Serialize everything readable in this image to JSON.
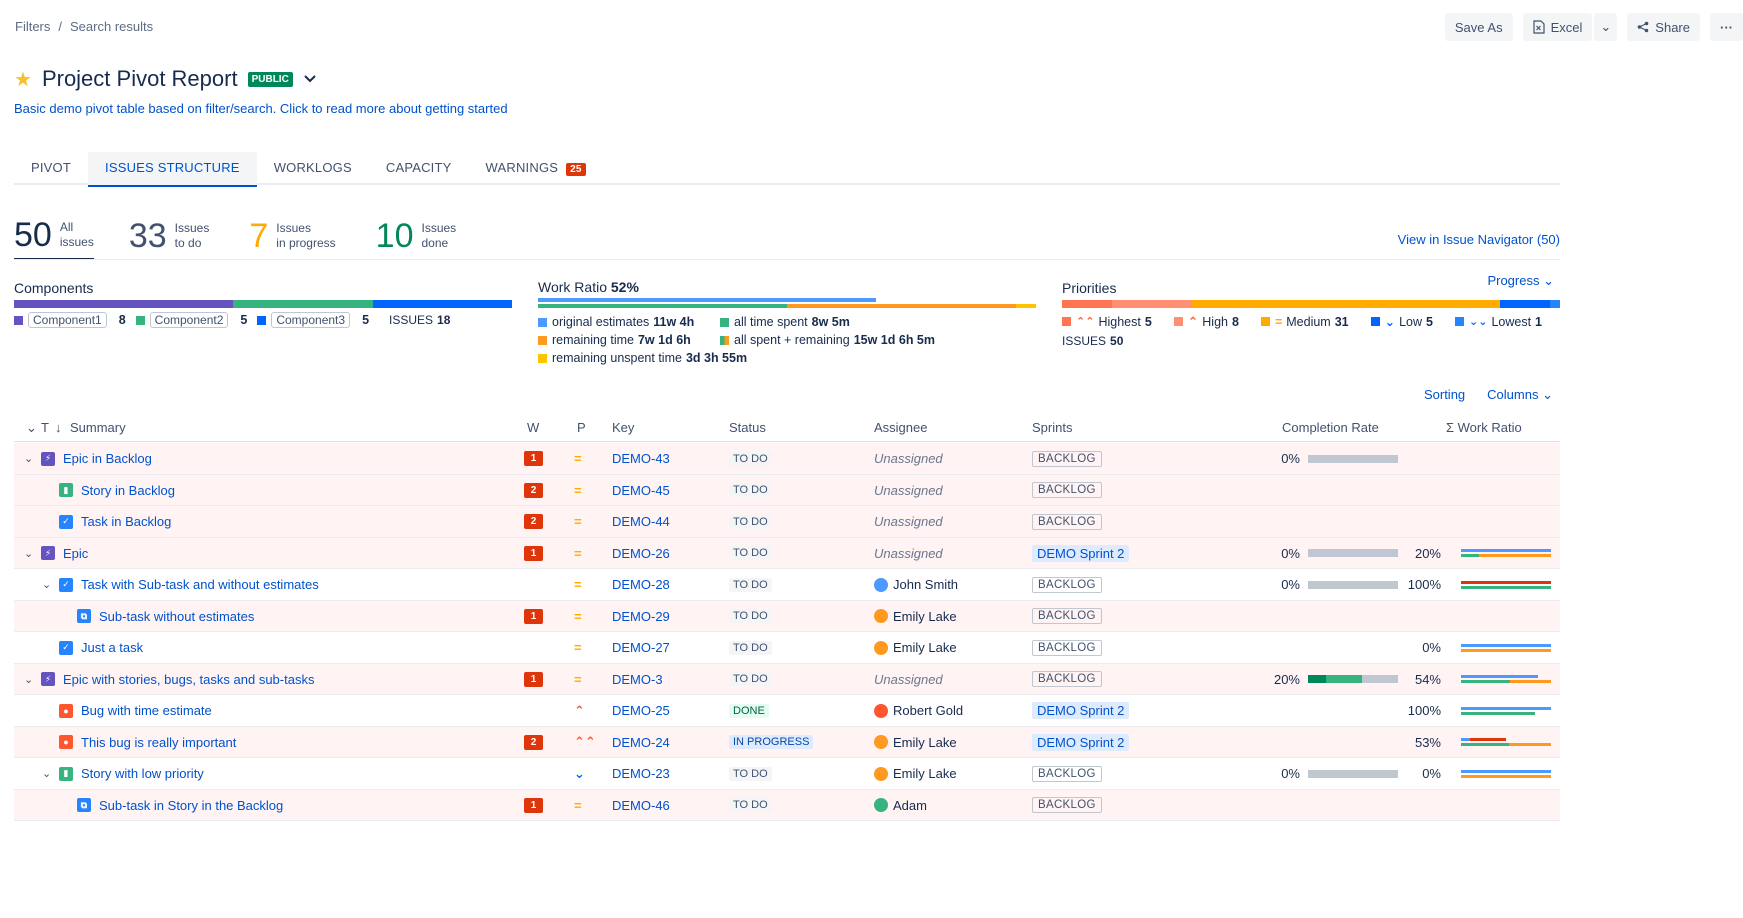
{
  "breadcrumb": [
    "Filters",
    "/",
    "Search results"
  ],
  "toolbar": {
    "save_as": "Save As",
    "excel": "Excel",
    "share": "Share",
    "more": "···"
  },
  "title": "Project Pivot Report",
  "public_badge": "PUBLIC",
  "subtitle": "Basic demo pivot table based on filter/search. Click to read more about getting started",
  "tabs": [
    {
      "label": "PIVOT"
    },
    {
      "label": "ISSUES STRUCTURE",
      "active": true
    },
    {
      "label": "WORKLOGS"
    },
    {
      "label": "CAPACITY"
    },
    {
      "label": "WARNINGS",
      "count": "25"
    }
  ],
  "stats": [
    {
      "num": "50",
      "l1": "All",
      "l2": "issues",
      "color": "#172b4d"
    },
    {
      "num": "33",
      "l1": "Issues",
      "l2": "to do",
      "color": "#42526e"
    },
    {
      "num": "7",
      "l1": "Issues",
      "l2": "in progress",
      "color": "#ffab00"
    },
    {
      "num": "10",
      "l1": "Issues",
      "l2": "done",
      "color": "#00875a"
    }
  ],
  "navigator_link": "View in Issue Navigator (50)",
  "components": {
    "title": "Components",
    "items": [
      {
        "label": "Component1",
        "count": "8",
        "color": "#6554c0"
      },
      {
        "label": "Component2",
        "count": "5",
        "color": "#36b37e"
      },
      {
        "label": "Component3",
        "count": "5",
        "color": "#0065ff"
      }
    ],
    "issues_label": "ISSUES",
    "issues_count": "18"
  },
  "work_ratio": {
    "title": "Work Ratio",
    "percent": "52%",
    "items": [
      {
        "label": "original estimates",
        "value": "11w 4h",
        "color": "#4c9aff"
      },
      {
        "label": "all time spent",
        "value": "8w 5m",
        "color": "#36b37e"
      },
      {
        "label": "remaining time",
        "value": "7w 1d 6h",
        "color": "#ff991f"
      },
      {
        "label": "all spent + remaining",
        "value": "15w 1d 6h 5m",
        "color": "#ffab00"
      },
      {
        "label": "remaining unspent time",
        "value": "3d 3h 55m",
        "color": "#ffc400"
      }
    ]
  },
  "priorities": {
    "title": "Priorities",
    "dropdown": "Progress",
    "items": [
      {
        "label": "Highest",
        "count": "5",
        "color": "#ff7452",
        "icon": "⌃"
      },
      {
        "label": "High",
        "count": "8",
        "color": "#ff8f73",
        "icon": "⌃"
      },
      {
        "label": "Medium",
        "count": "31",
        "color": "#ffab00",
        "icon": "="
      },
      {
        "label": "Low",
        "count": "5",
        "color": "#0065ff",
        "icon": "⌄"
      },
      {
        "label": "Lowest",
        "count": "1",
        "color": "#2684ff",
        "icon": "⌄"
      }
    ],
    "issues_label": "ISSUES",
    "issues_count": "50"
  },
  "table_tools": {
    "sorting": "Sorting",
    "columns": "Columns"
  },
  "columns": {
    "t": "T",
    "summary": "Summary",
    "w": "W",
    "p": "P",
    "key": "Key",
    "status": "Status",
    "assignee": "Assignee",
    "sprints": "Sprints",
    "completion": "Completion Rate",
    "work_ratio": "Σ Work Ratio"
  },
  "rows": [
    {
      "summary": "Epic in Backlog",
      "type": "epic",
      "indent": 0,
      "toggle": true,
      "w": "1",
      "prio": "medium",
      "key": "DEMO-43",
      "status": "TO DO",
      "assignee": "Unassigned",
      "sprint": "BACKLOG",
      "sprint_active": false,
      "completion": "0%",
      "completion_parts": [],
      "wr": "",
      "wr_lines": [],
      "pink": true
    },
    {
      "summary": "Story in Backlog",
      "type": "story",
      "indent": 1,
      "toggle": false,
      "w": "2",
      "prio": "medium",
      "key": "DEMO-45",
      "status": "TO DO",
      "assignee": "Unassigned",
      "sprint": "BACKLOG",
      "sprint_active": false,
      "completion": "",
      "completion_parts": [],
      "wr": "",
      "wr_lines": [],
      "pink": true
    },
    {
      "summary": "Task in Backlog",
      "type": "task",
      "indent": 1,
      "toggle": false,
      "w": "2",
      "prio": "medium",
      "key": "DEMO-44",
      "status": "TO DO",
      "assignee": "Unassigned",
      "sprint": "BACKLOG",
      "sprint_active": false,
      "completion": "",
      "completion_parts": [],
      "wr": "",
      "wr_lines": [],
      "pink": true
    },
    {
      "summary": "Epic",
      "type": "epic",
      "indent": 0,
      "toggle": true,
      "w": "1",
      "prio": "medium",
      "key": "DEMO-26",
      "status": "TO DO",
      "assignee": "Unassigned",
      "sprint": "DEMO Sprint 2",
      "sprint_active": true,
      "completion": "0%",
      "completion_parts": [],
      "wr": "20%",
      "wr_lines": [
        [
          [
            "#4c9aff",
            1
          ]
        ],
        [
          [
            "#36b37e",
            0.2
          ],
          [
            "#ff991f",
            0.8
          ]
        ]
      ],
      "pink": true
    },
    {
      "summary": "Task with Sub-task and without estimates",
      "type": "task",
      "indent": 1,
      "toggle": true,
      "w": "",
      "prio": "medium",
      "key": "DEMO-28",
      "status": "TO DO",
      "assignee": "John Smith",
      "avatar": "#4c9aff",
      "sprint": "BACKLOG",
      "sprint_active": false,
      "completion": "0%",
      "completion_parts": [],
      "wr": "100%",
      "wr_lines": [
        [
          [
            "#de350b",
            1
          ]
        ],
        [
          [
            "#36b37e",
            1
          ]
        ]
      ],
      "pink": false
    },
    {
      "summary": "Sub-task without estimates",
      "type": "subtask",
      "indent": 2,
      "toggle": false,
      "w": "1",
      "prio": "medium",
      "key": "DEMO-29",
      "status": "TO DO",
      "assignee": "Emily Lake",
      "avatar": "#ff991f",
      "sprint": "BACKLOG",
      "sprint_active": false,
      "completion": "",
      "completion_parts": [],
      "wr": "",
      "wr_lines": [],
      "pink": true
    },
    {
      "summary": "Just a task",
      "type": "task",
      "indent": 1,
      "toggle": false,
      "w": "",
      "prio": "medium",
      "key": "DEMO-27",
      "status": "TO DO",
      "assignee": "Emily Lake",
      "avatar": "#ff991f",
      "sprint": "BACKLOG",
      "sprint_active": false,
      "completion": "",
      "completion_parts": [],
      "wr": "0%",
      "wr_lines": [
        [
          [
            "#4c9aff",
            1
          ]
        ],
        [
          [
            "#ff991f",
            1
          ]
        ]
      ],
      "pink": false
    },
    {
      "summary": "Epic with stories, bugs, tasks and sub-tasks",
      "type": "epic",
      "indent": 0,
      "toggle": true,
      "w": "1",
      "prio": "medium",
      "key": "DEMO-3",
      "status": "TO DO",
      "assignee": "Unassigned",
      "sprint": "BACKLOG",
      "sprint_active": false,
      "completion": "20%",
      "completion_parts": [
        [
          "#00875a",
          0.2
        ],
        [
          "#36b37e",
          0.4
        ]
      ],
      "wr": "54%",
      "wr_lines": [
        [
          [
            "#4c9aff",
            0.85
          ]
        ],
        [
          [
            "#36b37e",
            0.54
          ],
          [
            "#ff991f",
            0.46
          ]
        ]
      ],
      "pink": true
    },
    {
      "summary": "Bug with time estimate",
      "type": "bug",
      "indent": 1,
      "toggle": false,
      "w": "",
      "prio": "high",
      "key": "DEMO-25",
      "status": "DONE",
      "assignee": "Robert Gold",
      "avatar": "#ff5630",
      "sprint": "DEMO Sprint 2",
      "sprint_active": true,
      "completion": "",
      "completion_parts": [],
      "wr": "100%",
      "wr_lines": [
        [
          [
            "#4c9aff",
            1
          ]
        ],
        [
          [
            "#36b37e",
            0.82
          ]
        ]
      ],
      "pink": false
    },
    {
      "summary": "This bug is really important",
      "type": "bug",
      "indent": 1,
      "toggle": false,
      "w": "2",
      "prio": "highest",
      "key": "DEMO-24",
      "status": "IN PROGRESS",
      "assignee": "Emily Lake",
      "avatar": "#ff991f",
      "sprint": "DEMO Sprint 2",
      "sprint_active": true,
      "completion": "",
      "completion_parts": [],
      "wr": "53%",
      "wr_lines": [
        [
          [
            "#4c9aff",
            0.1
          ],
          [
            "#de350b",
            0.4
          ]
        ],
        [
          [
            "#36b37e",
            0.53
          ],
          [
            "#ff991f",
            0.47
          ]
        ]
      ],
      "pink": true
    },
    {
      "summary": "Story with low priority",
      "type": "story",
      "indent": 1,
      "toggle": true,
      "w": "",
      "prio": "low",
      "key": "DEMO-23",
      "status": "TO DO",
      "assignee": "Emily Lake",
      "avatar": "#ff991f",
      "sprint": "BACKLOG",
      "sprint_active": false,
      "completion": "0%",
      "completion_parts": [],
      "wr": "0%",
      "wr_lines": [
        [
          [
            "#4c9aff",
            1
          ]
        ],
        [
          [
            "#ff991f",
            1
          ]
        ]
      ],
      "pink": false
    },
    {
      "summary": "Sub-task in Story in the Backlog",
      "type": "subtask",
      "indent": 2,
      "toggle": false,
      "w": "1",
      "prio": "medium",
      "key": "DEMO-46",
      "status": "TO DO",
      "assignee": "Adam",
      "avatar": "#36b37e",
      "sprint": "BACKLOG",
      "sprint_active": false,
      "completion": "",
      "completion_parts": [],
      "wr": "",
      "wr_lines": [],
      "pink": true
    }
  ]
}
